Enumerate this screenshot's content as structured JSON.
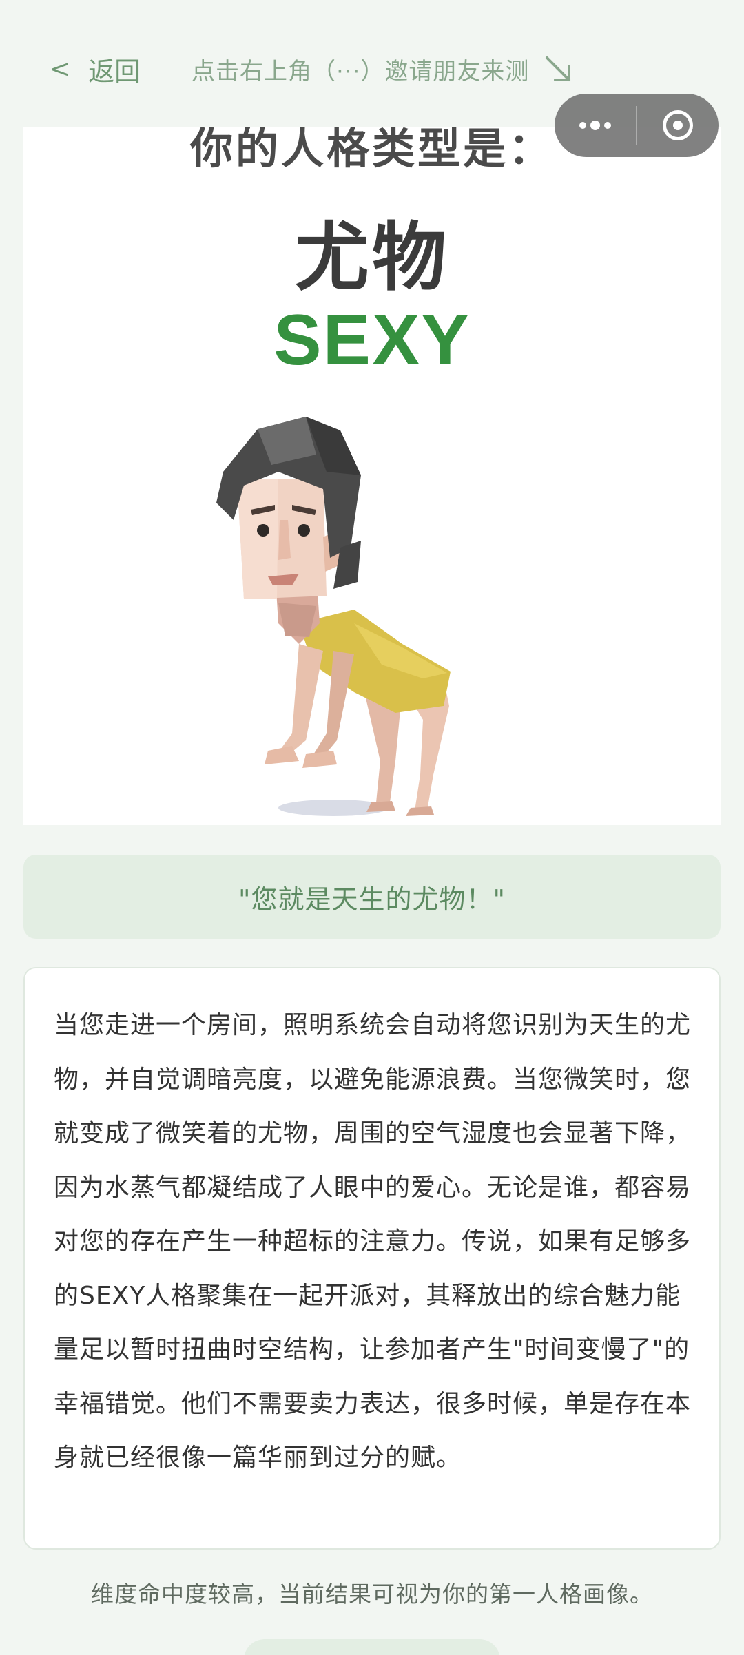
{
  "header": {
    "back_chevron": "<",
    "back_label": "返回",
    "invite_hint": "点击右上角（···）邀请朋友来测",
    "invite_arrow_icon": "arrow-down-right-icon"
  },
  "capsule": {
    "more_icon": "more-dots-icon",
    "close_icon": "target-circle-icon"
  },
  "result_image": {
    "heading": "你的人格类型是：",
    "type_cn": "尤物",
    "type_en": "SEXY"
  },
  "quote": "\"您就是天生的尤物！\"",
  "description": "当您走进一个房间，照明系统会自动将您识别为天生的尤物，并自觉调暗亮度，以避免能源浪费。当您微笑时，您就变成了微笑着的尤物，周围的空气湿度也会显著下降，因为水蒸气都凝结成了人眼中的爱心。无论是谁，都容易对您的存在产生一种超标的注意力。传说，如果有足够多的SEXY人格聚集在一起开派对，其释放出的综合魅力能量足以暂时扭曲时空结构，让参加者产生\"时间变慢了\"的幸福错觉。他们不需要卖力表达，很多时候，单是存在本身就已经很像一篇华丽到过分的赋。",
  "footer_note": "维度命中度较高，当前结果可视为你的第一人格画像。",
  "colors": {
    "background": "#f2f6f2",
    "accent_green": "#35913f",
    "text_green": "#6f9873",
    "quote_bg": "#e3eee3"
  }
}
